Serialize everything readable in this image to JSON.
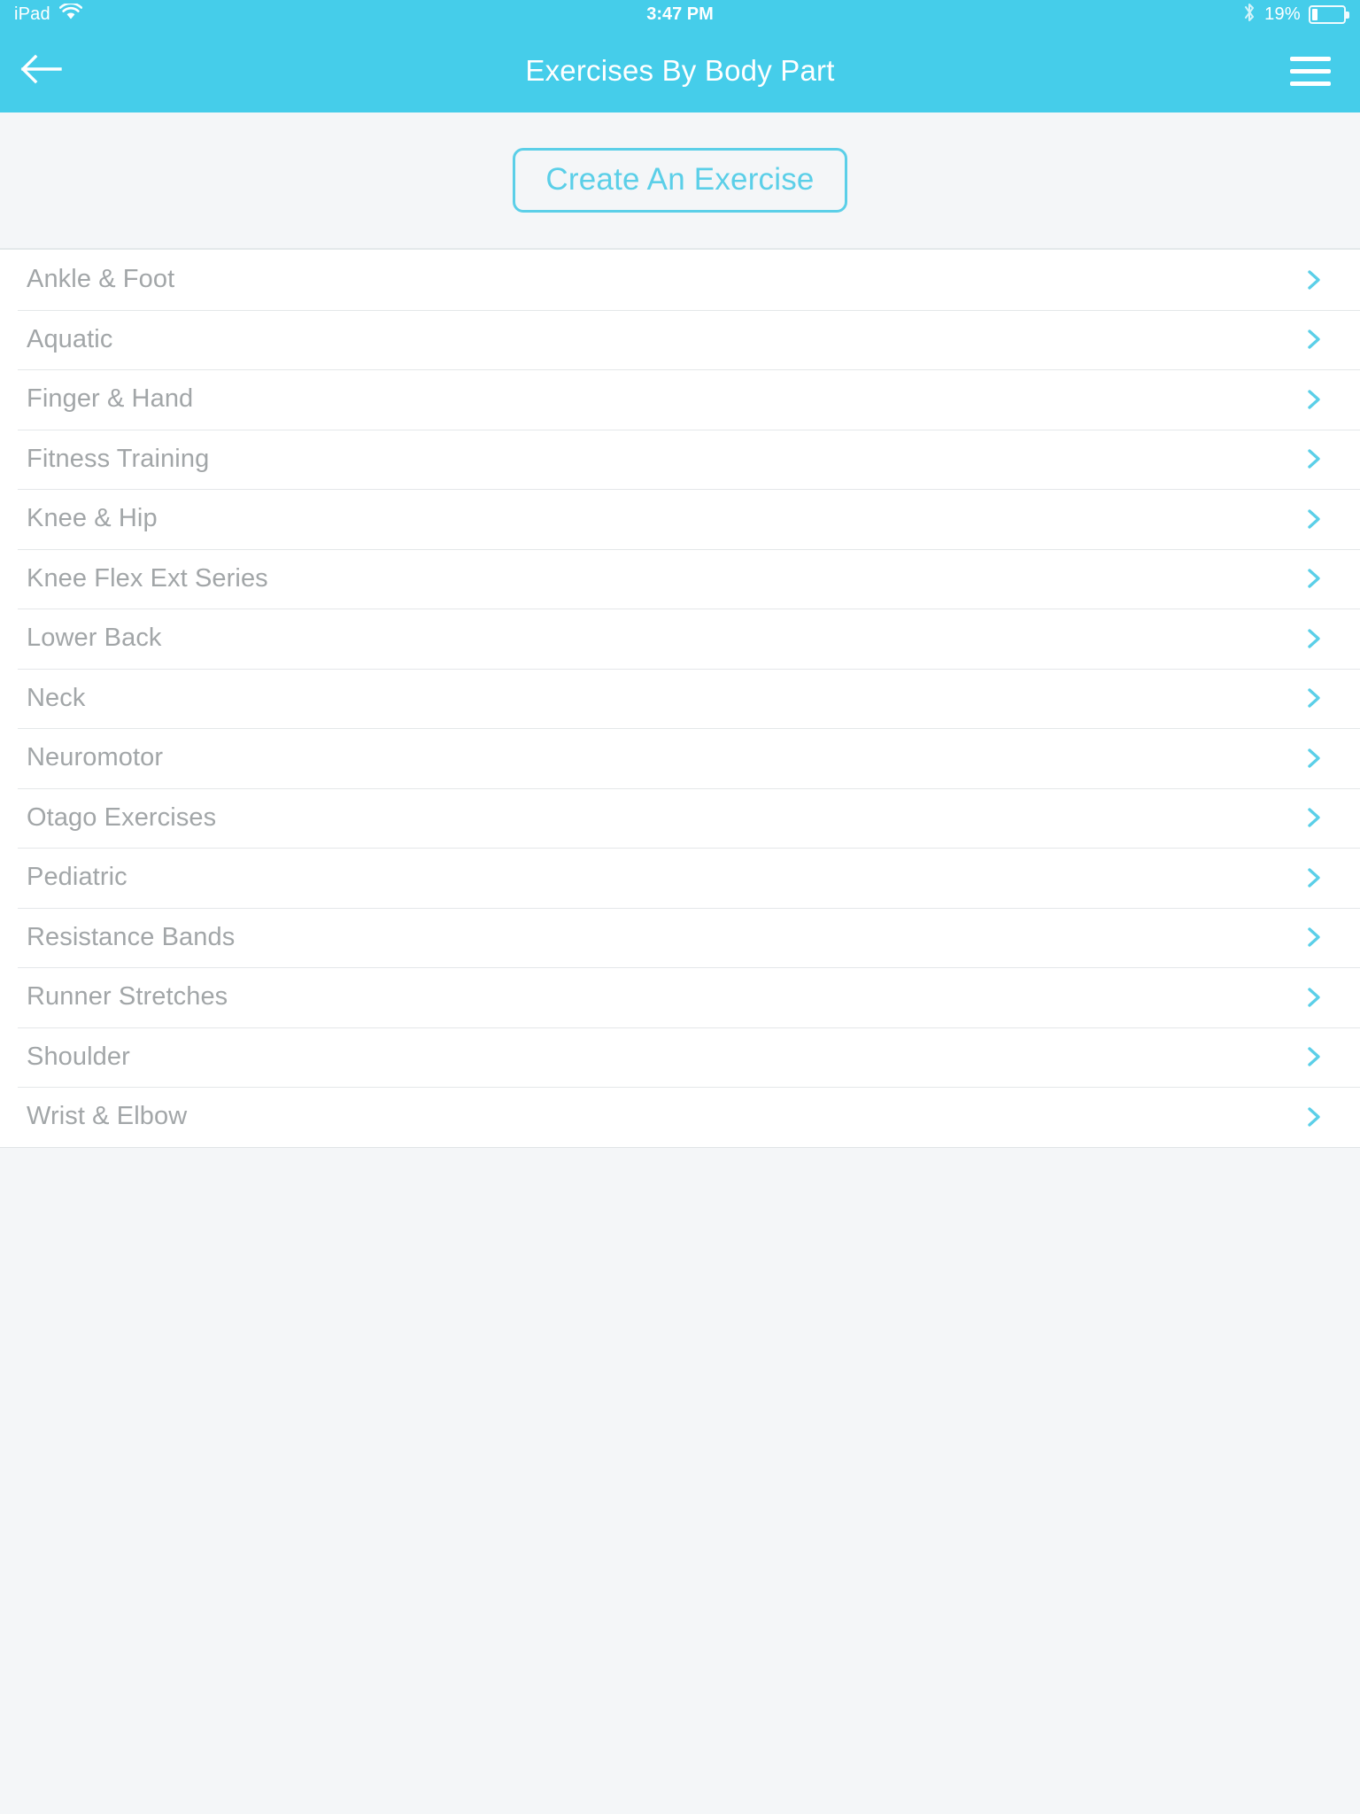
{
  "status_bar": {
    "carrier": "iPad",
    "wifi_icon": "wifi-icon",
    "time": "3:47 PM",
    "bluetooth_icon": "bluetooth-icon",
    "battery_percent": "19%",
    "battery_level": 19,
    "battery_icon": "battery-icon"
  },
  "nav_bar": {
    "back_icon": "back-arrow-icon",
    "title": "Exercises By Body Part",
    "menu_icon": "hamburger-menu-icon"
  },
  "action_bar": {
    "create_button_label": "Create An Exercise"
  },
  "list": {
    "chevron_icon": "chevron-right-icon",
    "items": [
      {
        "label": "Ankle & Foot"
      },
      {
        "label": "Aquatic"
      },
      {
        "label": "Finger & Hand"
      },
      {
        "label": "Fitness Training"
      },
      {
        "label": "Knee & Hip"
      },
      {
        "label": "Knee Flex Ext Series"
      },
      {
        "label": "Lower Back"
      },
      {
        "label": "Neck"
      },
      {
        "label": "Neuromotor"
      },
      {
        "label": "Otago Exercises"
      },
      {
        "label": "Pediatric"
      },
      {
        "label": "Resistance Bands"
      },
      {
        "label": "Runner Stretches"
      },
      {
        "label": "Shoulder"
      },
      {
        "label": "Wrist & Elbow"
      }
    ]
  },
  "colors": {
    "brand_blue": "#45cdea",
    "accent_blue": "#5bcfe8",
    "page_background": "#f4f6f8",
    "list_background": "#ffffff",
    "list_text": "#a2a6a8",
    "separator": "#e4e7e9"
  }
}
